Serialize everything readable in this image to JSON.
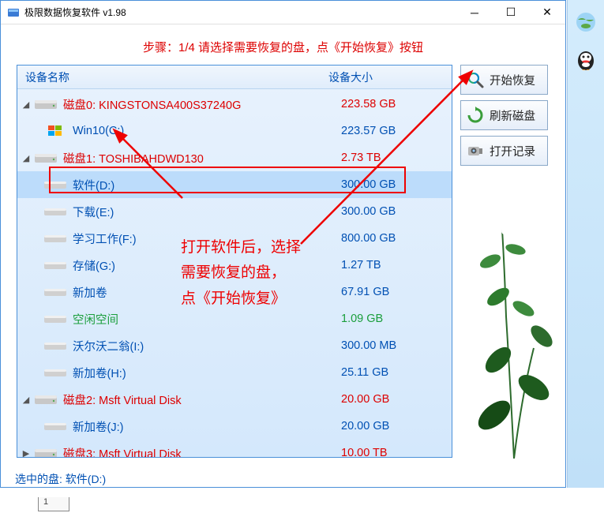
{
  "window": {
    "title": "极限数据恢复软件 v1.98"
  },
  "banner": "步骤：1/4 请选择需要恢复的盘，点《开始恢复》按钮",
  "headers": {
    "name": "设备名称",
    "size": "设备大小"
  },
  "tree": [
    {
      "level": 0,
      "expanded": true,
      "icon": "disk",
      "label": "磁盘0: KINGSTONSA400S37240G",
      "size": "223.58 GB",
      "color": "red"
    },
    {
      "level": 1,
      "icon": "win",
      "label": "Win10(C:)",
      "size": "223.57 GB",
      "color": "blue"
    },
    {
      "level": 0,
      "expanded": true,
      "icon": "disk",
      "label": "磁盘1: TOSHIBAHDWD130",
      "size": "2.73 TB",
      "color": "red"
    },
    {
      "level": 1,
      "icon": "vol",
      "label": "软件(D:)",
      "size": "300.00 GB",
      "color": "blue",
      "selected": true
    },
    {
      "level": 1,
      "icon": "vol",
      "label": "下载(E:)",
      "size": "300.00 GB",
      "color": "blue"
    },
    {
      "level": 1,
      "icon": "vol",
      "label": "学习工作(F:)",
      "size": "800.00 GB",
      "color": "blue"
    },
    {
      "level": 1,
      "icon": "vol",
      "label": "存储(G:)",
      "size": "1.27 TB",
      "color": "blue"
    },
    {
      "level": 1,
      "icon": "vol",
      "label": "新加卷",
      "size": "67.91 GB",
      "color": "blue"
    },
    {
      "level": 1,
      "icon": "vol",
      "label": "空闲空间",
      "size": "1.09 GB",
      "color": "green"
    },
    {
      "level": 1,
      "icon": "vol",
      "label": "沃尔沃二翁(I:)",
      "size": "300.00 MB",
      "color": "blue"
    },
    {
      "level": 1,
      "icon": "vol",
      "label": "新加卷(H:)",
      "size": "25.11 GB",
      "color": "blue"
    },
    {
      "level": 0,
      "expanded": true,
      "icon": "disk",
      "label": "磁盘2: Msft    Virtual Disk",
      "size": "20.00 GB",
      "color": "red"
    },
    {
      "level": 1,
      "icon": "vol",
      "label": "新加卷(J:)",
      "size": "20.00 GB",
      "color": "blue"
    },
    {
      "level": 0,
      "expanded": false,
      "icon": "disk",
      "label": "磁盘3: Msft    Virtual Disk",
      "size": "10.00 TB",
      "color": "red"
    }
  ],
  "buttons": {
    "start": "开始恢复",
    "refresh": "刷新磁盘",
    "openrec": "打开记录"
  },
  "status": "选中的盘: 软件(D:)",
  "annotation": {
    "line1": "打开软件后，选择",
    "line2": "需要恢复的盘，",
    "line3": "点《开始恢复》"
  },
  "bottom_tab": "1"
}
